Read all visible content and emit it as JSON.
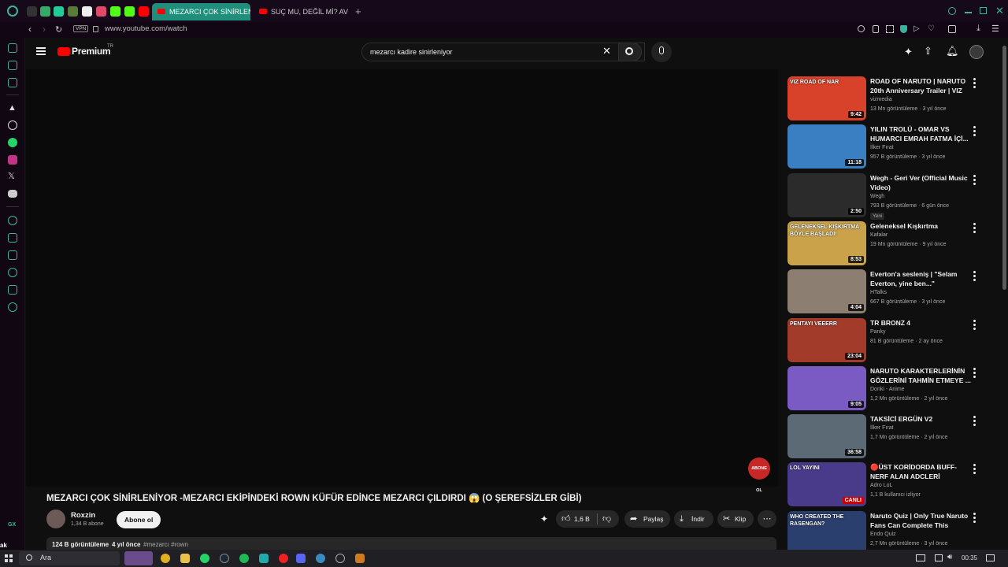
{
  "browser": {
    "tabs": [
      {
        "label": "MEZARCI ÇOK SİNİRLENİ",
        "active": true
      },
      {
        "label": "SUÇ MU, DEĞİL Mİ? AVUK",
        "active": false
      }
    ],
    "new_tab": "+",
    "vpn_badge": "VPN",
    "url": "www.youtube.com/watch"
  },
  "sidebar": {
    "bottom_label": "GX"
  },
  "youtube": {
    "logo_text": "Premium",
    "logo_sup": "TR",
    "search_value": "mezarcı kadire sinirleniyor",
    "subscribe_sticker": "ABONE OL",
    "video": {
      "title": "MEZARCI ÇOK SİNİRLENİYOR -MEZARCI EKİPİNDEKİ ROWN KÜFÜR EDİNCE MEZARCI ÇILDIRDI 😱 (O ŞEREFSİZLER GİBİ)",
      "channel": "Roxzin",
      "subscribers": "1,34 B abone",
      "subscribe_label": "Abone ol",
      "likes": "1,6 B",
      "share_label": "Paylaş",
      "download_label": "İndir",
      "clip_label": "Klip",
      "views": "124 B görüntüleme",
      "age": "4 yıl önce",
      "tags": "#mezarcı #rown"
    },
    "recommendations": [
      {
        "title": "ROAD OF NARUTO | NARUTO 20th Anniversary Trailer | VIZ",
        "channel": "vizmedia",
        "meta": "13 Mn görüntüleme · 3 yıl önce",
        "duration": "9:42",
        "color": "#d8412a",
        "thumb_text": "VIZ ROAD OF NAR",
        "badge": ""
      },
      {
        "title": "YILIN TROLÜ - OMAR VS HUMARCI EMRAH FATMA İÇİ...",
        "channel": "İlker Fırat",
        "meta": "957 B görüntüleme · 3 yıl önce",
        "duration": "11:18",
        "color": "#3a7fc1",
        "thumb_text": "",
        "badge": ""
      },
      {
        "title": "Wegh - Geri Ver (Official Music Video)",
        "channel": "Wegh",
        "meta": "793 B görüntüleme · 6 gün önce",
        "duration": "2:50",
        "color": "#2b2b2b",
        "thumb_text": "",
        "badge": "Yeni"
      },
      {
        "title": "Geleneksel Kışkırtma",
        "channel": "Kafalar",
        "meta": "19 Mn görüntüleme · 9 yıl önce",
        "duration": "8:53",
        "color": "#c9a24a",
        "thumb_text": "GELENEKSEL KIŞKIRTMA BÖYLE BAŞLADI!",
        "badge": ""
      },
      {
        "title": "Everton'a sesleniş | \"Selam Everton, yine ben...\"",
        "channel": "HTalks",
        "meta": "667 B görüntüleme · 3 yıl önce",
        "duration": "4:04",
        "color": "#8c7f72",
        "thumb_text": "",
        "badge": ""
      },
      {
        "title": "TR BRONZ 4",
        "channel": "Panky",
        "meta": "81 B görüntüleme · 2 ay önce",
        "duration": "23:04",
        "color": "#a23b2a",
        "thumb_text": "PENTAYI VEEERR",
        "badge": ""
      },
      {
        "title": "NARUTO KARAKTERLERİNİN GÖZLERİNİ TAHMİN ETMEYE ...",
        "channel": "Donki - Anime",
        "meta": "1,2 Mn görüntüleme · 2 yıl önce",
        "duration": "9:05",
        "color": "#7a5bc4",
        "thumb_text": "",
        "badge": ""
      },
      {
        "title": "TAKSİCİ ERGÜN V2",
        "channel": "İlker Fırat",
        "meta": "1,7 Mn görüntüleme · 2 yıl önce",
        "duration": "36:58",
        "color": "#5b6a74",
        "thumb_text": "",
        "badge": ""
      },
      {
        "title": "🔴ÜST KORİDORDA BUFF-NERF ALAN ADCLERİ OYNUYORUZ!",
        "channel": "Adro LoL",
        "meta": "1,1 B kullanıcı izliyor",
        "duration": "CANLI",
        "color": "#4a3a8a",
        "thumb_text": "LOL YAYINI",
        "badge": ""
      },
      {
        "title": "Naruto Quiz | Only True Naruto Fans Can Complete This Narut...",
        "channel": "Endo Quiz",
        "meta": "2,7 Mn görüntüleme · 3 yıl önce",
        "duration": "",
        "color": "#2a3f6e",
        "thumb_text": "WHO CREATED THE RASENGAN?",
        "badge": ""
      }
    ]
  },
  "taskbar": {
    "search_label": "Ara",
    "clock": "00:35",
    "left_label": "ak"
  }
}
